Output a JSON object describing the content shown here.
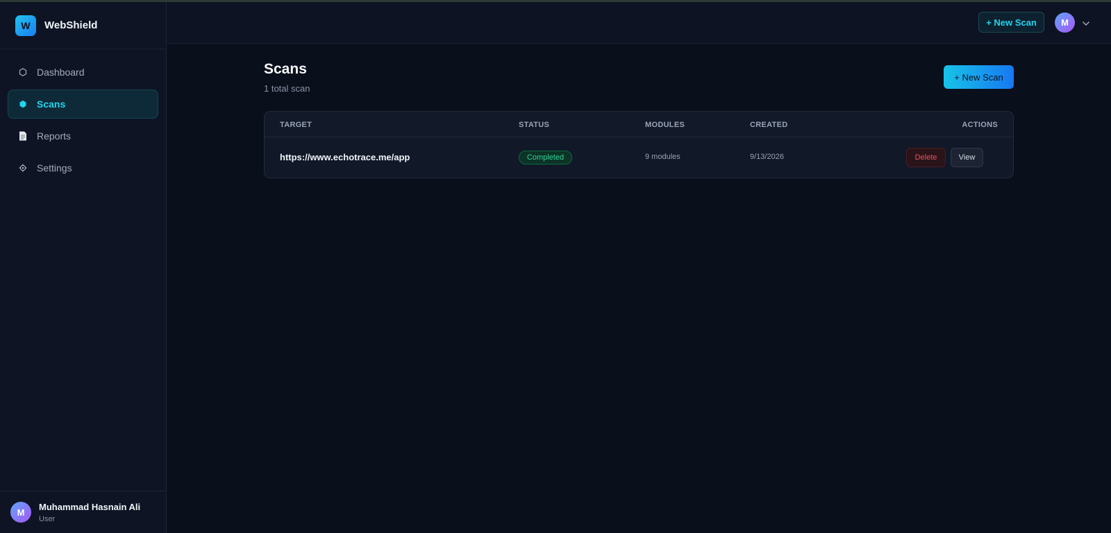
{
  "app": {
    "logo_letter": "W",
    "name": "WebShield"
  },
  "sidebar": {
    "items": [
      {
        "label": "Dashboard",
        "icon": "hexagon-outline-icon",
        "active": false
      },
      {
        "label": "Scans",
        "icon": "hexagon-filled-icon",
        "active": true
      },
      {
        "label": "Reports",
        "icon": "document-icon",
        "active": false
      },
      {
        "label": "Settings",
        "icon": "gear-icon",
        "active": false
      }
    ],
    "user": {
      "initial": "M",
      "name": "Muhammad Hasnain Ali",
      "role": "User"
    }
  },
  "topbar": {
    "new_scan_label": "+ New Scan",
    "avatar_initial": "M",
    "menu_icon": "chevron-down-icon"
  },
  "page": {
    "title": "Scans",
    "subtitle": "1 total scan",
    "new_scan_label": "+ New Scan"
  },
  "table": {
    "columns": [
      "TARGET",
      "STATUS",
      "MODULES",
      "CREATED",
      "ACTIONS"
    ],
    "rows": [
      {
        "target": "https://www.echotrace.me/app",
        "status": "Completed",
        "modules": "9 modules",
        "created": "9/13/2026",
        "delete_label": "Delete",
        "view_label": "View"
      }
    ]
  },
  "colors": {
    "accent": "#22d3ee",
    "background": "#0a0f1c",
    "sidebar": "#0e1423",
    "status_completed": "#34d399",
    "danger": "#ef4f5f"
  }
}
